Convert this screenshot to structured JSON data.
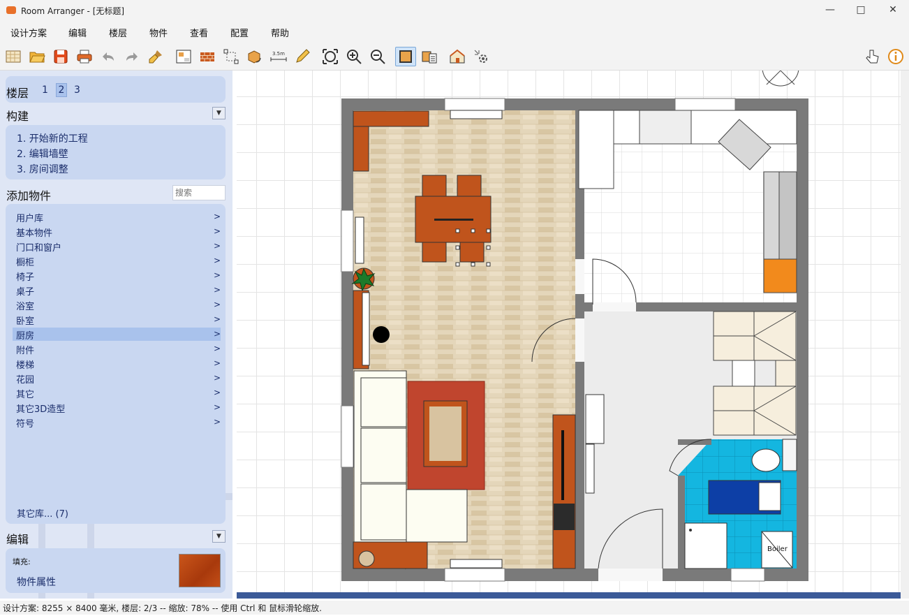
{
  "window": {
    "title": "Room Arranger - [无标题]",
    "minimize_icon": "minimize-icon",
    "maximize_icon": "maximize-icon",
    "close_icon": "close-icon"
  },
  "menu": [
    "设计方案",
    "编辑",
    "楼层",
    "物件",
    "查看",
    "配置",
    "帮助"
  ],
  "toolbar": {
    "icons": [
      "new-project-icon",
      "open-folder-icon",
      "save-icon",
      "print-icon",
      "undo-icon",
      "redo-icon",
      "brush-icon",
      "edit-room-icon",
      "wall-icon",
      "resize-icon",
      "rotate-object-icon",
      "dimension-icon",
      "pencil-icon",
      "zoom-fit-icon",
      "zoom-in-icon",
      "zoom-out-icon",
      "view-2d-icon",
      "object-list-icon",
      "3d-view-icon",
      "settings-icon",
      "touch-icon",
      "info-icon"
    ],
    "dimension_label": "3.5m"
  },
  "sidebar": {
    "floors": {
      "label": "楼层",
      "items": [
        "1",
        "2",
        "3"
      ],
      "selected": "2"
    },
    "build": {
      "title": "构建",
      "steps": [
        "1. 开始新的工程",
        "2. 编辑墙壁",
        "3. 房间调整"
      ]
    },
    "add_objects": {
      "title": "添加物件",
      "search_placeholder": "搜索",
      "categories": [
        "用户库",
        "基本物件",
        "门口和窗户",
        "橱柜",
        "椅子",
        "桌子",
        "浴室",
        "卧室",
        "厨房",
        "附件",
        "楼梯",
        "花园",
        "其它",
        "其它3D造型",
        "符号"
      ],
      "selected": "厨房",
      "other_libraries": "其它库... (7)"
    },
    "edit": {
      "title": "编辑",
      "fill_label": "填充:",
      "properties_label": "物件属性",
      "fill_color": "#b5460f"
    }
  },
  "floorplan": {
    "boiler_label": "Boiler",
    "colors": {
      "wall": "#7a7a7a",
      "wood_floor": "#e2d3b6",
      "kitchen_floor": "#ffffff",
      "furniture_wood": "#c0541c",
      "rug": "#c0452e",
      "bathroom_tile": "#14b6e0",
      "bathtub": "#0d3fa6",
      "stairs": "#f6eedd",
      "kitchen_accent": "#f28a1c",
      "sofa": "#fdfdf2"
    }
  },
  "statusbar": {
    "text": "设计方案: 8255 × 8400 毫米, 楼层: 2/3 -- 缩放: 78% -- 使用 Ctrl 和 鼠标滑轮缩放."
  }
}
